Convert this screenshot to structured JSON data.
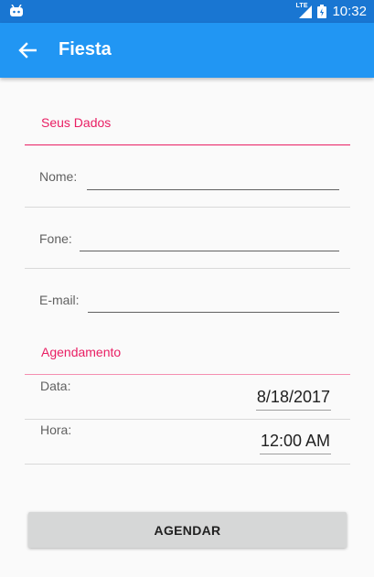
{
  "status_bar": {
    "network": "LTE",
    "time": "10:32"
  },
  "app_bar": {
    "title": "Fiesta",
    "back_icon": "arrow-left-icon"
  },
  "sections": {
    "dados": "Seus Dados",
    "agendamento": "Agendamento"
  },
  "fields": {
    "nome_label": "Nome:",
    "nome_value": "",
    "fone_label": "Fone:",
    "fone_value": "",
    "email_label": "E-mail:",
    "email_value": ""
  },
  "schedule": {
    "data_label": "Data:",
    "data_value": "8/18/2017",
    "hora_label": "Hora:",
    "hora_value": "12:00 AM"
  },
  "button": {
    "label": "AGENDAR"
  },
  "colors": {
    "status_bar": "#1976d2",
    "app_bar": "#2196f3",
    "accent": "#e91e63"
  }
}
